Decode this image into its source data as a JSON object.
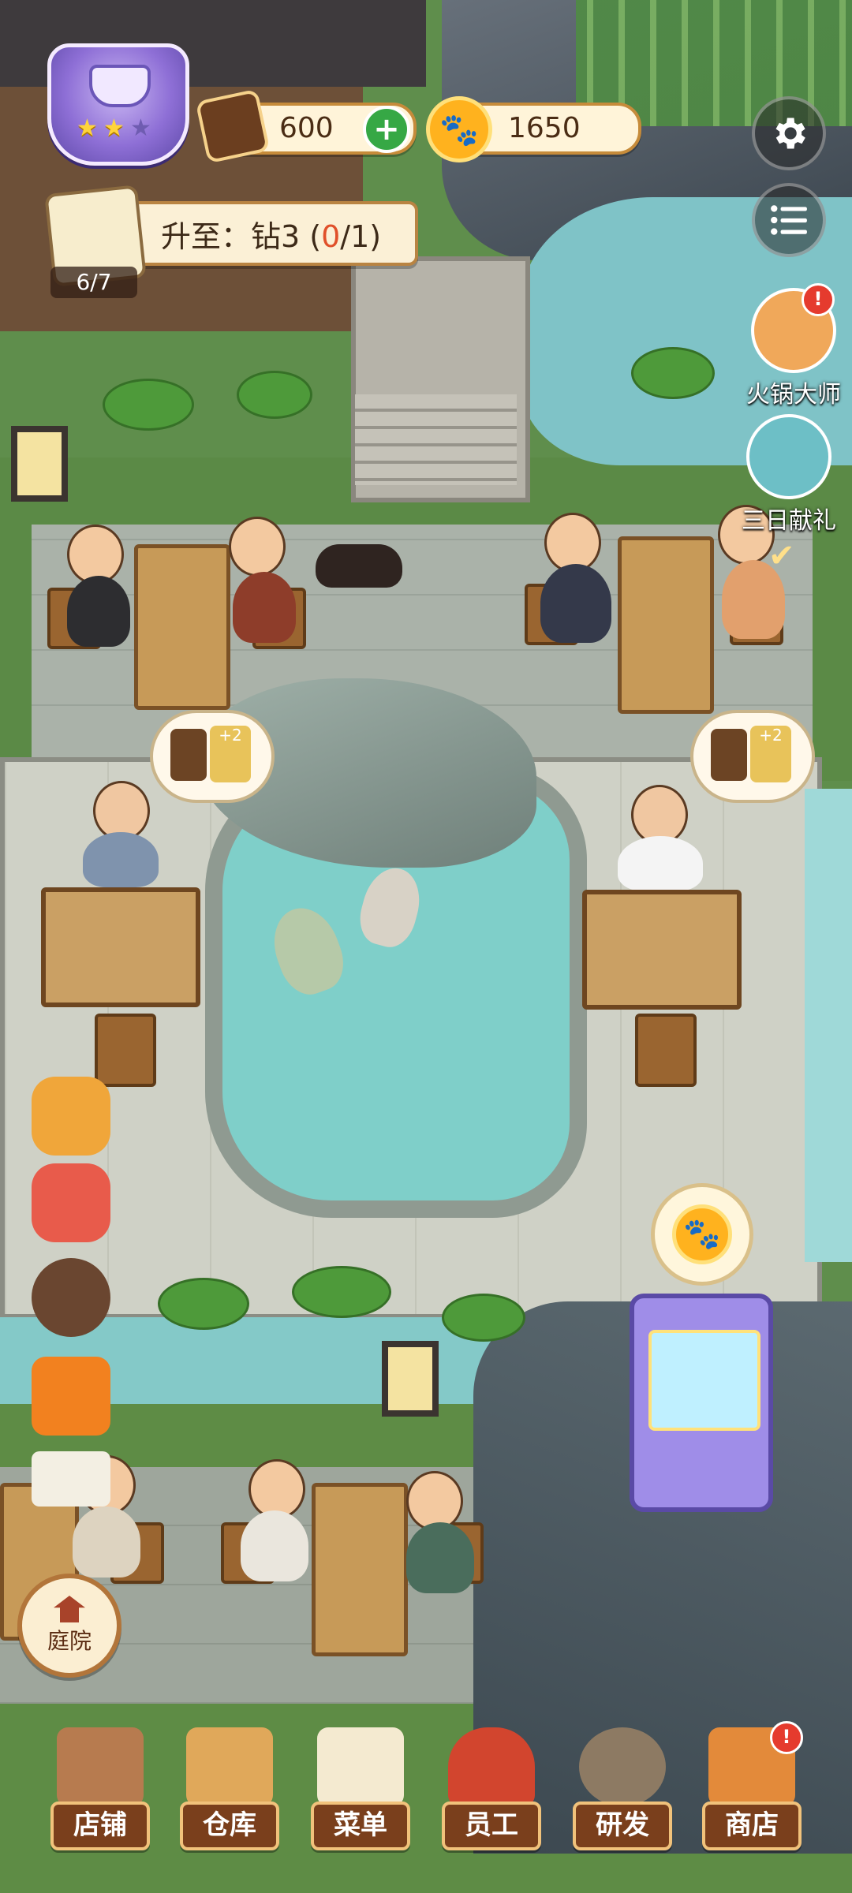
{
  "hud": {
    "chestnut_amount": "600",
    "paw_coins": "1650",
    "rank_stars_filled": 2,
    "rank_stars_total": 3
  },
  "quest": {
    "label_prefix": "升至：钻3 (",
    "progress_current": "0",
    "progress_suffix": "/1)",
    "task_counter": "6/7"
  },
  "events": [
    {
      "label": "火锅大师",
      "has_alert": true
    },
    {
      "label": "三日献礼",
      "has_alert": false
    }
  ],
  "badges": {
    "plus_label": "+2"
  },
  "courtyard_button": {
    "label": "庭院"
  },
  "bottom_nav": [
    {
      "label": "店铺",
      "icon": "shop-building-icon",
      "alert": false
    },
    {
      "label": "仓库",
      "icon": "warehouse-boxes-icon",
      "alert": false
    },
    {
      "label": "菜单",
      "icon": "menu-clipboard-icon",
      "alert": false
    },
    {
      "label": "员工",
      "icon": "staff-girl-icon",
      "alert": false
    },
    {
      "label": "研发",
      "icon": "research-pot-icon",
      "alert": false
    },
    {
      "label": "商店",
      "icon": "store-stall-icon",
      "alert": true
    }
  ],
  "colors": {
    "nav_label_bg": "#7a3f1c",
    "coin": "#ffb21e",
    "plus": "#36a845",
    "alert": "#e53b2e"
  }
}
